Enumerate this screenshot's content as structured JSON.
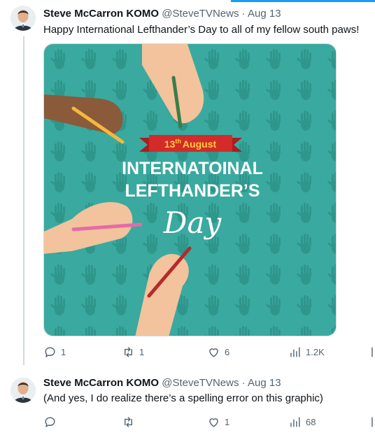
{
  "tweets": [
    {
      "name": "Steve McCarron KOMO",
      "handle": "@SteveTVNews",
      "separator": "·",
      "date": "Aug 13",
      "text": "Happy International Lefthander’s Day to all of my fellow south paws!",
      "media": {
        "banner_day": "13",
        "banner_sup": "th",
        "banner_month": "August",
        "title_line1": "INTERNATOINAL",
        "title_line2": "LEFTHANDER’S",
        "script": "Day"
      },
      "actions": {
        "replies": "1",
        "retweets": "1",
        "likes": "6",
        "views": "1.2K"
      }
    },
    {
      "name": "Steve McCarron KOMO",
      "handle": "@SteveTVNews",
      "separator": "·",
      "date": "Aug 13",
      "text": "(And yes, I do realize there’s a spelling error on this graphic)",
      "actions": {
        "replies": "",
        "retweets": "",
        "likes": "1",
        "views": "68"
      }
    }
  ],
  "colors": {
    "accent": "#1d9bf0",
    "teal_bg": "#3aa99f",
    "banner_red": "#d42a2a",
    "banner_text": "#f7d23a"
  },
  "icons": [
    "reply-icon",
    "retweet-icon",
    "like-icon",
    "views-icon",
    "share-icon"
  ]
}
